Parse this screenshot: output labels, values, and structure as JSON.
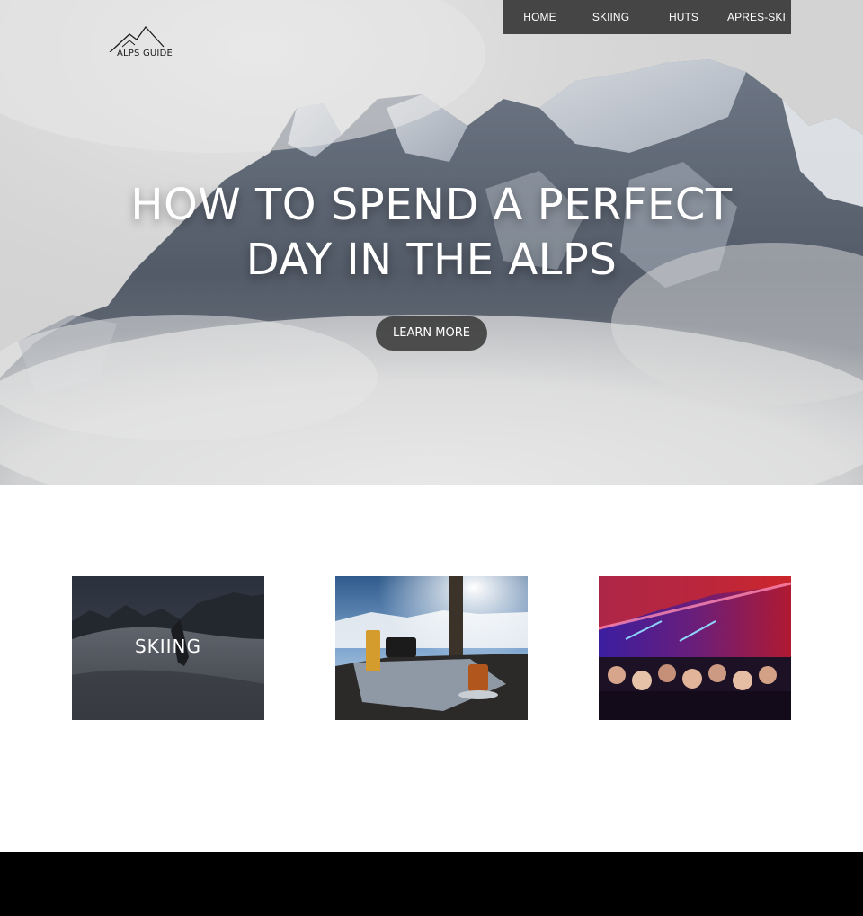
{
  "logo": {
    "text": "ALPS GUIDE"
  },
  "nav": {
    "items": [
      {
        "label": "HOME"
      },
      {
        "label": "SKIING"
      },
      {
        "label": "HUTS"
      },
      {
        "label": "APRES-SKI"
      }
    ]
  },
  "hero": {
    "title_line1": "HOW TO SPEND A PERFECT",
    "title_line2": "DAY IN THE ALPS",
    "cta_label": "LEARN MORE"
  },
  "cards": [
    {
      "label": "SKIING"
    },
    {
      "label": ""
    },
    {
      "label": ""
    }
  ]
}
